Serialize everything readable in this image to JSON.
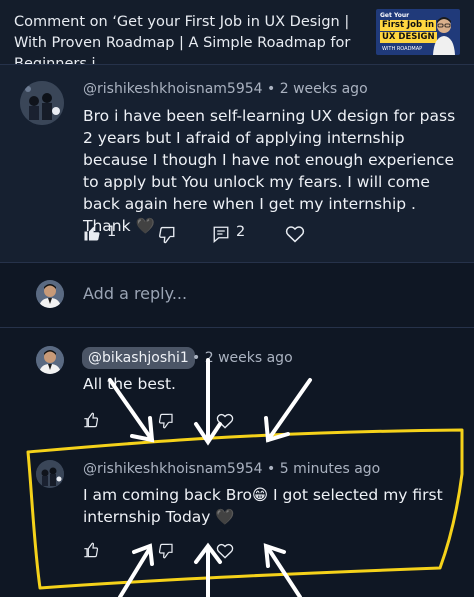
{
  "header": {
    "title": "Comment on ‘Get your First Job in UX Design | With Proven Roadmap | A Simple Roadmap for Beginners i..."
  },
  "thumbnail": {
    "small_top": "Get Your",
    "line1": "First Job in",
    "line2": "UX DESIGN",
    "small_bottom": "WITH ROADMAP"
  },
  "main_comment": {
    "author": "@rishikeshkhoisnam5954",
    "time": "2 weeks ago",
    "text": "Bro i have been self-learning UX design for pass 2 years but I afraid of applying internship because I though I have not enough experience to apply but You unlock my fears. I will come back again here when I get my internship . Thank 🖤",
    "likes": "1",
    "replies": "2"
  },
  "reply_box": {
    "placeholder": "Add a reply..."
  },
  "replies": [
    {
      "author": "@bikashjoshi1",
      "time": "2 weeks ago",
      "text": "All the best."
    },
    {
      "author": "@rishikeshkhoisnam5954",
      "time": "5 minutes ago",
      "text": "I am coming back Bro😁 I got selected my first internship Today 🖤"
    }
  ],
  "icons": {
    "like": "thumbs-up-icon",
    "dislike": "thumbs-down-icon",
    "reply": "comment-icon",
    "heart": "heart-icon"
  },
  "colors": {
    "background": "#0f1724",
    "main_comment_bg": "#162030",
    "highlight": "#f5d21a",
    "arrows": "#ffffff",
    "mention_chip": "#4b5566"
  }
}
